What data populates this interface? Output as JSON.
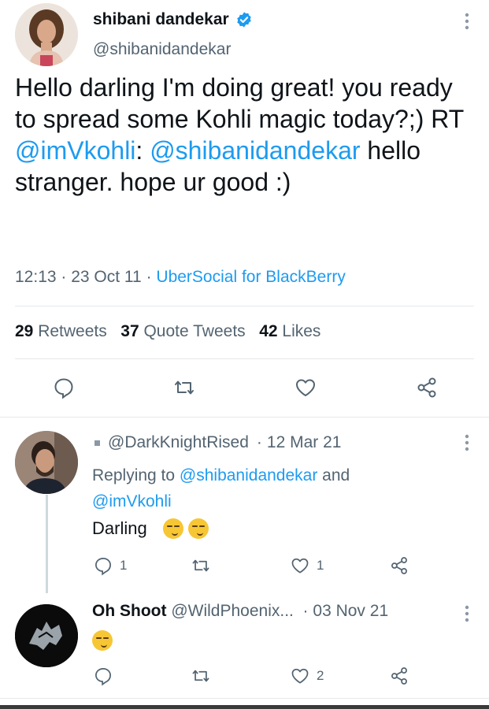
{
  "main_tweet": {
    "display_name": "shibani dandekar",
    "handle": "@shibanidandekar",
    "text_1": "Hello darling I'm doing great! you ready to spread some Kohli magic today?;) RT ",
    "mention_1": "@imVkohli",
    "text_2": ": ",
    "mention_2": "@shibanidandekar",
    "text_3": " hello stranger. hope ur good :)",
    "time": "12:13",
    "date": "23 Oct 11",
    "source": "UberSocial for BlackBerry",
    "retweets_count": "29",
    "retweets_label": "Retweets",
    "quotes_count": "37",
    "quotes_label": "Quote Tweets",
    "likes_count": "42",
    "likes_label": "Likes"
  },
  "reply_1": {
    "handle": "@DarkKnightRised",
    "date": "12 Mar 21",
    "replying_prefix": "Replying to ",
    "replying_mention_1": "@shibanidandekar",
    "replying_and": " and",
    "replying_mention_2": "@imVkohli",
    "text": "Darling",
    "reply_count": "1",
    "like_count": "1"
  },
  "reply_2": {
    "display_name": "Oh Shoot",
    "handle": "@WildPhoenix...",
    "date": "03 Nov 21",
    "like_count": "2"
  },
  "colors": {
    "link": "#1d9bf0",
    "muted": "#536471",
    "text": "#0f1419",
    "divider": "#e7e9ea"
  },
  "icons": [
    "verified-badge-icon",
    "more-icon",
    "reply-icon",
    "retweet-icon",
    "like-icon",
    "share-icon",
    "smirk-emoji"
  ]
}
